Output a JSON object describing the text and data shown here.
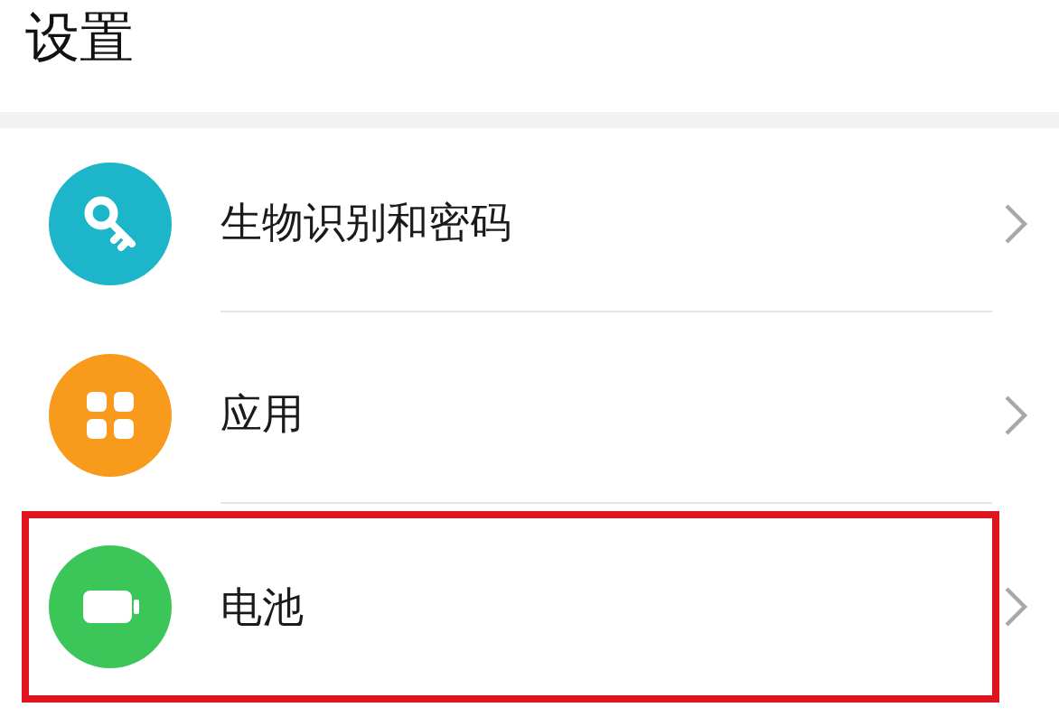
{
  "header": {
    "title": "设置"
  },
  "items": [
    {
      "label": "生物识别和密码",
      "kind": "key",
      "color": "#1db5c9",
      "highlighted": false
    },
    {
      "label": "应用",
      "kind": "apps",
      "color": "#f89a1c",
      "highlighted": false
    },
    {
      "label": "电池",
      "kind": "battery",
      "color": "#3cc65a",
      "highlighted": true
    }
  ]
}
